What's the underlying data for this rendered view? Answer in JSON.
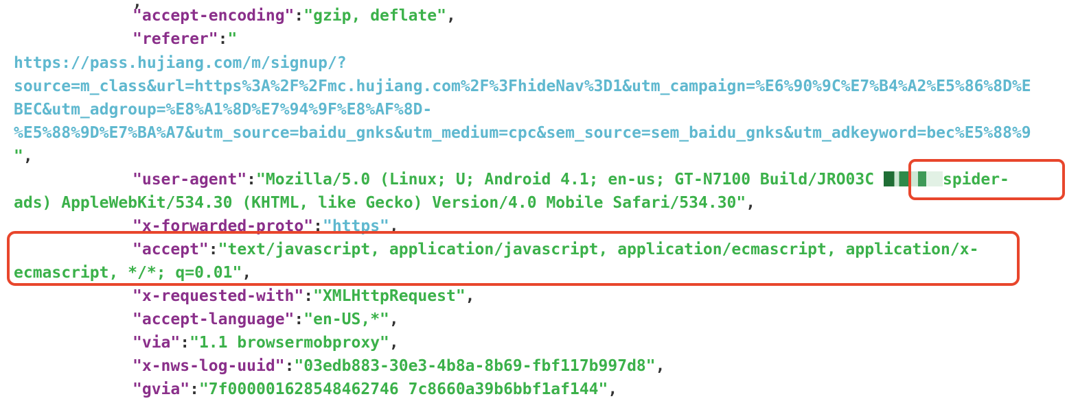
{
  "lines": {
    "accept_encoding": {
      "key": "\"accept-encoding\"",
      "value": "\"gzip, deflate\""
    },
    "referer": {
      "key": "\"referer\"",
      "value_open": "\""
    },
    "url_lines": [
      "https://pass.hujiang.com/m/signup/?",
      "source=m_class&url=https%3A%2F%2Fmc.hujiang.com%2F%3FhideNav%3D1&utm_campaign=%E6%90%9C%E7%B4%A2%E5%86%8D%E",
      "BEC&utm_adgroup=%E8%A1%8D%E7%94%9F%E8%AF%8D-",
      "%E5%88%9D%E7%BA%A7&utm_source=baidu_gnks&utm_medium=cpc&sem_source=sem_baidu_gnks&utm_adkeyword=bec%E5%88%9"
    ],
    "url_close": "\"",
    "user_agent": {
      "key": "\"user-agent\"",
      "value_part1": "\"Mozilla/5.0 (Linux; U; Android 4.1; en-us; GT-N7100 Build/JRO03C",
      "value_part2": "spider-",
      "value_part3": "ads) AppleWebKit/534.30 (KHTML, like Gecko) Version/4.0 Mobile Safari/534.30\""
    },
    "x_forwarded_proto": {
      "key": "\"x-forwarded-proto\"",
      "value": "\"https\""
    },
    "accept": {
      "key": "\"accept\"",
      "value_part1": "\"text/javascript, application/javascript, application/ecmascript, application/x-",
      "value_part2": "ecmascript, */*; q=0.01\""
    },
    "x_requested_with": {
      "key": "\"x-requested-with\"",
      "value": "\"XMLHttpRequest\""
    },
    "accept_language": {
      "key": "\"accept-language\"",
      "value": "\"en-US,*\""
    },
    "via": {
      "key": "\"via\"",
      "value": "\"1.1 browsermobproxy\""
    },
    "x_nws_log_uuid": {
      "key": "\"x-nws-log-uuid\"",
      "value": "\"03edb883-30e3-4b8a-8b69-fbf117b997d8\""
    },
    "gvia": {
      "key": "\"gvia\"",
      "value": "\"7f000001628548462746 7c8660a39b6bbf1af144\""
    }
  },
  "punct": {
    "colon": ":",
    "comma": ","
  },
  "highlight_color": "#e8462c"
}
